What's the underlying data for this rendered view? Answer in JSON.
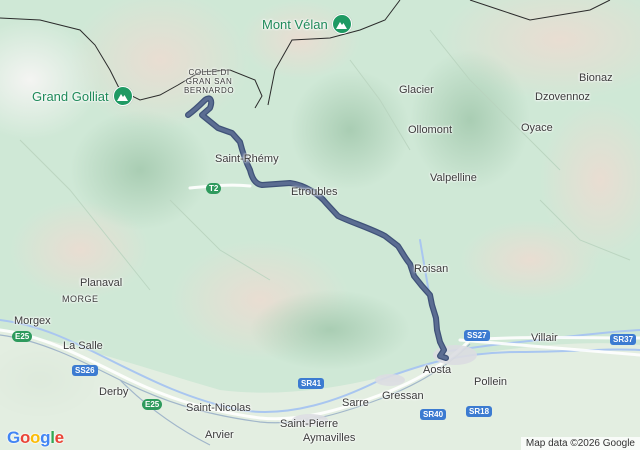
{
  "map": {
    "peaks": [
      {
        "name": "Mont Vélan",
        "icon": "mountain-icon"
      },
      {
        "name": "Grand Golliat",
        "icon": "mountain-icon"
      }
    ],
    "pass_label": [
      "COLLE DI",
      "GRAN SAN",
      "BERNARDO"
    ],
    "places": {
      "bionaz": "Bionaz",
      "glacier": "Glacier",
      "dzovennoz": "Dzovennoz",
      "ollomont": "Ollomont",
      "oyace": "Oyace",
      "saint_rhemy": "Saint-Rhémy",
      "etroubles": "Etroubles",
      "valpelline": "Valpelline",
      "roisan": "Roisan",
      "planaval": "Planaval",
      "morge": "MORGE",
      "morgex": "Morgex",
      "la_salle": "La Salle",
      "villair": "Villair",
      "aosta": "Aosta",
      "pollein": "Pollein",
      "derby": "Derby",
      "sarre": "Sarre",
      "gressan": "Gressan",
      "saint_nicolas": "Saint-Nicolas",
      "saint_pierre": "Saint-Pierre",
      "arvier": "Arvier",
      "aymavilles": "Aymavilles"
    },
    "road_shields": {
      "t2": "T2",
      "e25_west": "E25",
      "e25_south": "E25",
      "ss26": "SS26",
      "ss27": "SS27",
      "sr37": "SR37",
      "sr41": "SR41",
      "sr40": "SR40",
      "sr18": "SR18"
    },
    "route_color": "#5b6d92",
    "terrain_color": "#cfe8d6",
    "water_color": "#a9c6f0"
  },
  "branding": {
    "logo_letters": [
      {
        "ch": "G",
        "color": "#4285F4"
      },
      {
        "ch": "o",
        "color": "#EA4335"
      },
      {
        "ch": "o",
        "color": "#FBBC05"
      },
      {
        "ch": "g",
        "color": "#4285F4"
      },
      {
        "ch": "l",
        "color": "#34A853"
      },
      {
        "ch": "e",
        "color": "#EA4335"
      }
    ],
    "attribution": "Map data ©2026 Google"
  }
}
